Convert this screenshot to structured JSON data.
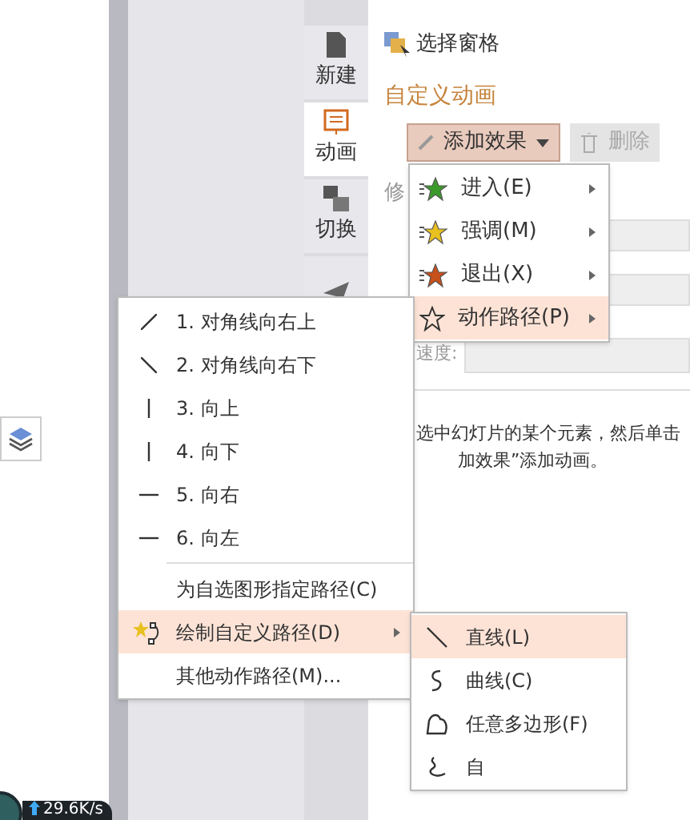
{
  "sidebar": {
    "items": [
      {
        "label": "新建",
        "kind": "file",
        "selected": false
      },
      {
        "label": "动画",
        "kind": "animation",
        "selected": true
      },
      {
        "label": "切换",
        "kind": "switch",
        "selected": false
      },
      {
        "kind": "send",
        "selected": false
      }
    ]
  },
  "panel": {
    "select_pane": "选择窗格",
    "section_title": "自定义动画",
    "add_button": "添加效果",
    "delete_button": {
      "label": "删除",
      "disabled": true
    },
    "modify_label": "修",
    "speed_label": "速度:",
    "hint_lines": [
      "选中幻灯片的某个元素，然后单击",
      "加效果”添加动画。"
    ]
  },
  "effect_menu": [
    {
      "label": "进入(E)",
      "kind": "enter",
      "selected": false
    },
    {
      "label": "强调(M)",
      "kind": "emphasis",
      "selected": false
    },
    {
      "label": "退出(X)",
      "kind": "exit",
      "selected": false
    },
    {
      "label": "动作路径(P)",
      "kind": "path",
      "selected": true
    }
  ],
  "path_menu": {
    "presets": [
      {
        "label": "1. 对角线向右上",
        "kind": "diag-up"
      },
      {
        "label": "2. 对角线向右下",
        "kind": "diag-down"
      },
      {
        "label": "3. 向上",
        "kind": "vertical"
      },
      {
        "label": "4. 向下",
        "kind": "vertical"
      },
      {
        "label": "5. 向右",
        "kind": "horizontal"
      },
      {
        "label": "6. 向左",
        "kind": "horizontal"
      }
    ],
    "items": [
      {
        "label": "为自选图形指定路径(C)",
        "kind": "plain",
        "selected": false,
        "submenu": false
      },
      {
        "label": "绘制自定义路径(D)",
        "kind": "draw",
        "selected": true,
        "submenu": true
      },
      {
        "label": "其他动作路径(M)...",
        "kind": "plain",
        "selected": false,
        "submenu": false
      }
    ]
  },
  "draw_menu": [
    {
      "label": "直线(L)",
      "kind": "line",
      "selected": true
    },
    {
      "label": "曲线(C)",
      "kind": "curve",
      "selected": false
    },
    {
      "label": "任意多边形(F)",
      "kind": "polygon",
      "selected": false
    },
    {
      "label": "自",
      "kind": "freeform",
      "selected": false
    }
  ],
  "net_speed": "29.6K/s"
}
